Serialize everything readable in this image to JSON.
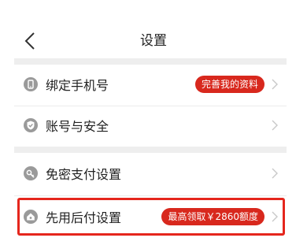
{
  "header": {
    "title": "设置",
    "back_icon": "chevron-left-icon"
  },
  "rows": [
    {
      "label": "绑定手机号",
      "icon": "phone-icon",
      "badge": "完善我的资料"
    },
    {
      "label": "账号与安全",
      "icon": "shield-icon"
    },
    {
      "label": "免密支付设置",
      "icon": "key-icon"
    },
    {
      "label": "先用后付设置",
      "icon": "house-icon",
      "badge": "最高领取￥2860额度"
    }
  ],
  "colors": {
    "accent": "#d8281d",
    "highlight": "#e5261d",
    "icon_gray": "#9a9a9a"
  }
}
